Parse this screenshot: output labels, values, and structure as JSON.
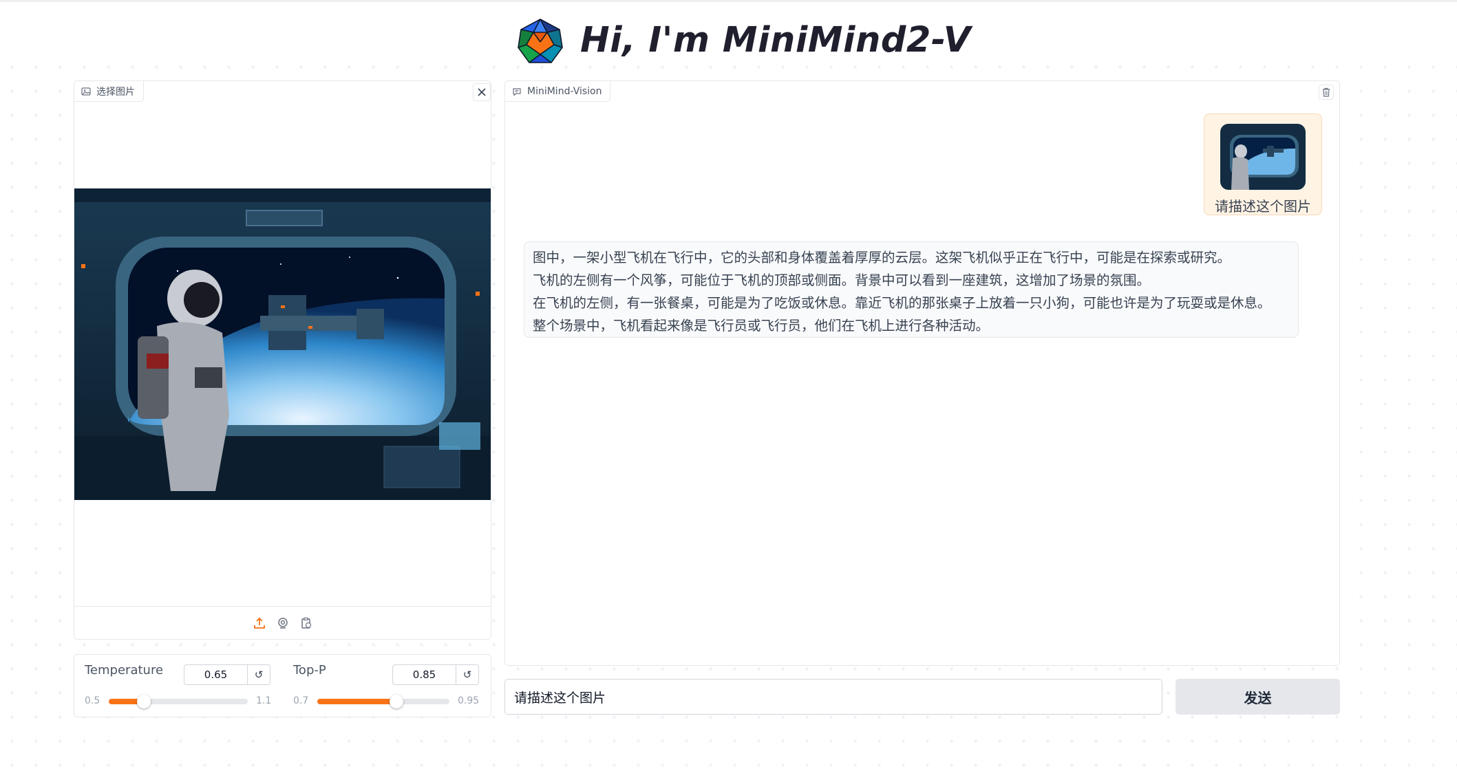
{
  "header": {
    "title": "Hi, I'm MiniMind2-V"
  },
  "image_panel": {
    "label": "选择图片",
    "icon": "image-icon",
    "toolbar_icons": [
      "upload-icon",
      "webcam-icon",
      "paste-clipboard-icon"
    ]
  },
  "chat": {
    "label": "MiniMind-Vision",
    "user_message": {
      "text": "请描述这个图片"
    },
    "bot_message": {
      "lines": [
        "图中，一架小型飞机在飞行中，它的头部和身体覆盖着厚厚的云层。这架飞机似乎正在飞行中，可能是在探索或研究。",
        "飞机的左侧有一个风筝，可能位于飞机的顶部或侧面。背景中可以看到一座建筑，这增加了场景的氛围。",
        "在飞机的左侧，有一张餐桌，可能是为了吃饭或休息。靠近飞机的那张桌子上放着一只小狗，可能也许是为了玩耍或是休息。",
        "整个场景中，飞机看起来像是飞行员或飞行员，他们在飞机上进行各种活动。"
      ]
    }
  },
  "controls": {
    "temperature": {
      "label": "Temperature",
      "value": "0.65",
      "min": "0.5",
      "max": "1.1",
      "fraction": 0.25
    },
    "top_p": {
      "label": "Top-P",
      "value": "0.85",
      "min": "0.7",
      "max": "0.95",
      "fraction": 0.6
    }
  },
  "input": {
    "value": "请描述这个图片",
    "send_label": "发送"
  },
  "colors": {
    "accent": "#f97316",
    "user_bubble": "#fff3e4",
    "bot_bubble": "#f9fafb"
  }
}
